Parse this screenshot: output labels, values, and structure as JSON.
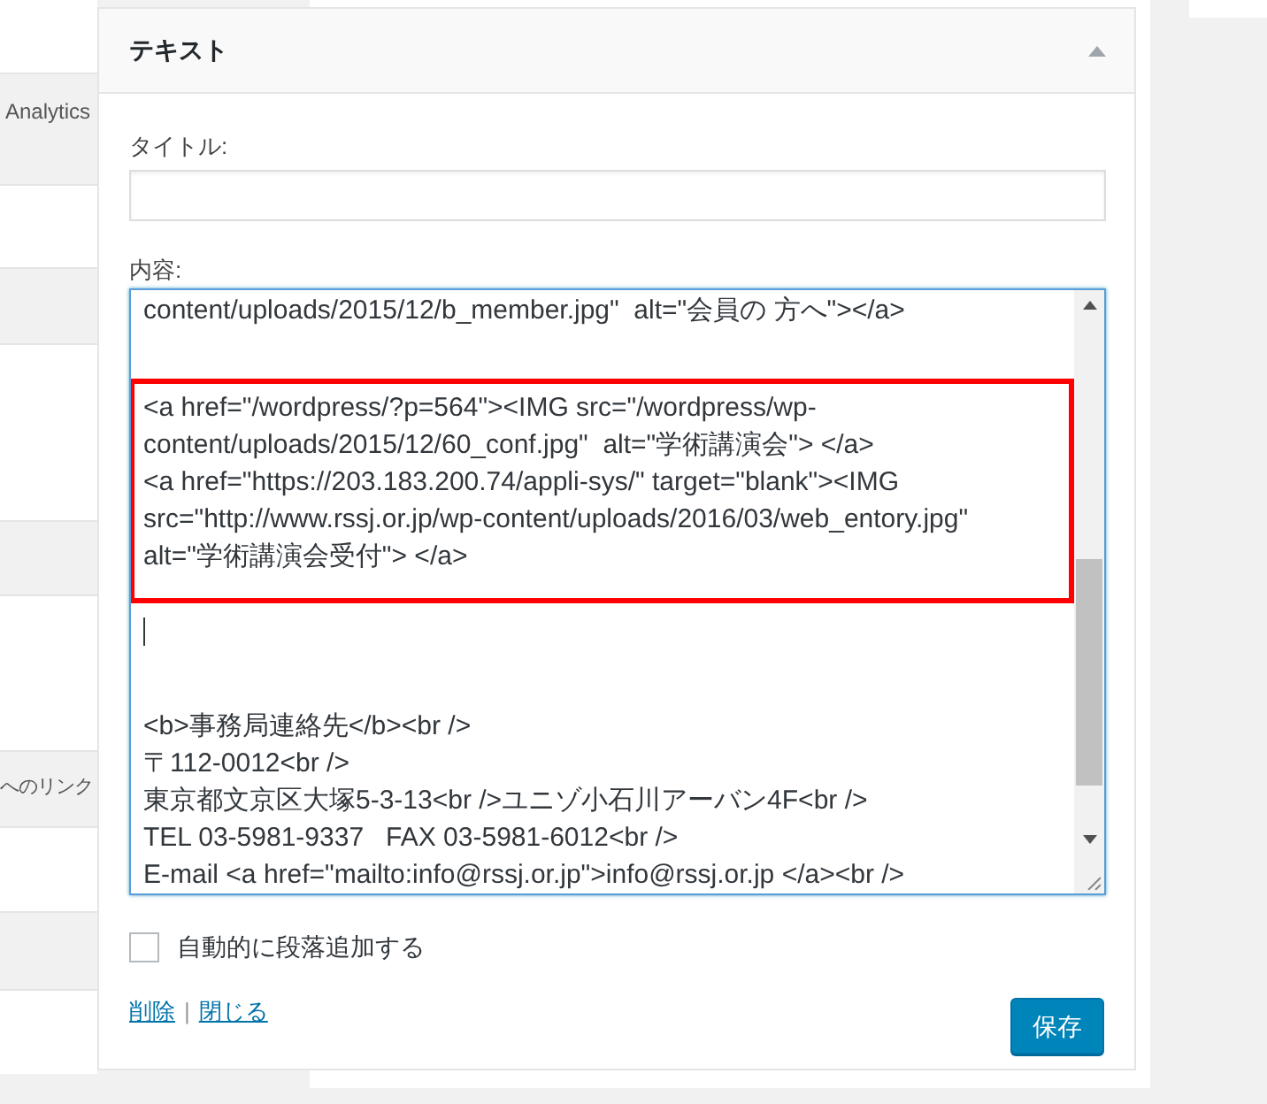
{
  "background_list": {
    "item": "Analytics"
  },
  "widget": {
    "title": "テキスト",
    "expanded": true,
    "title_field": {
      "label": "タイトル:"
    },
    "content_field": {
      "label": "内容:",
      "blocks": [
        {
          "kind": "text",
          "highlighted": false,
          "lines": [
            "content/uploads/2015/12/b_member.jpg\"  alt=\"会員の 方へ\"></a>"
          ]
        },
        {
          "kind": "text",
          "highlighted": true,
          "lines": [
            "<a href=\"/wordpress/?p=564\"><IMG src=\"/wordpress/wp-",
            "content/uploads/2015/12/60_conf.jpg\"  alt=\"学術講演会\"> </a>",
            "<a href=\"https://203.183.200.74/appli-sys/\" target=\"blank\"><IMG",
            "src=\"http://www.rssj.or.jp/wp-content/uploads/2016/03/web_entory.jpg\"",
            "alt=\"学術講演会受付\"> </a>"
          ]
        },
        {
          "kind": "caret"
        },
        {
          "kind": "text",
          "highlighted": false,
          "lines": [
            "<b>事務局連絡先</b><br />",
            "〒112-0012<br />",
            "東京都文京区大塚5-3-13<br />ユニゾ小石川アーバン4F<br />",
            "TEL 03-5981-9337   FAX 03-5981-6012<br />",
            "E-mail <a href=\"mailto:info@rssj.or.jp\">info@rssj.or.jp </a><br />"
          ]
        }
      ]
    },
    "auto_paragraph": {
      "label": "自動的に段落追加する",
      "checked": false
    },
    "links": [
      "削除",
      "閉じる"
    ],
    "separator": "|",
    "save_button": "保存"
  },
  "side_list": {
    "item": "へのリンク"
  }
}
